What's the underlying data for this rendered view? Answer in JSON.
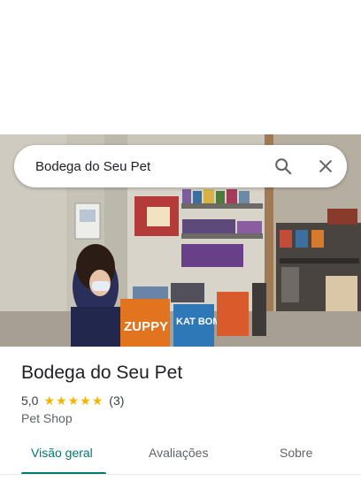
{
  "search": {
    "value": "Bodega do Seu Pet"
  },
  "place": {
    "name": "Bodega do Seu Pet",
    "rating": "5,0",
    "stars": 5,
    "review_count": "(3)",
    "category": "Pet Shop",
    "photo_bag_brand": "ZUPPY",
    "photo_bag_brand_2": "KAT BOM"
  },
  "tabs": [
    {
      "label": "Visão geral",
      "active": true
    },
    {
      "label": "Avaliações",
      "active": false
    },
    {
      "label": "Sobre",
      "active": false
    }
  ],
  "colors": {
    "accent": "#01796f",
    "star": "#f6b400"
  },
  "icons": {
    "search": "search-icon",
    "close": "close-icon"
  }
}
